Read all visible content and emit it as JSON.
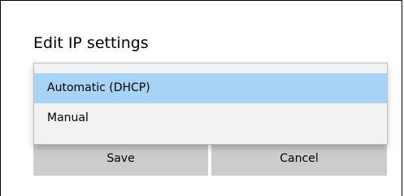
{
  "dialog": {
    "title": "Edit IP settings"
  },
  "dropdown": {
    "options": [
      {
        "label": "Automatic (DHCP)",
        "selected": true
      },
      {
        "label": "Manual",
        "selected": false
      }
    ],
    "selected_color": "#a9d2f7"
  },
  "buttons": {
    "save_label": "Save",
    "cancel_label": "Cancel"
  }
}
